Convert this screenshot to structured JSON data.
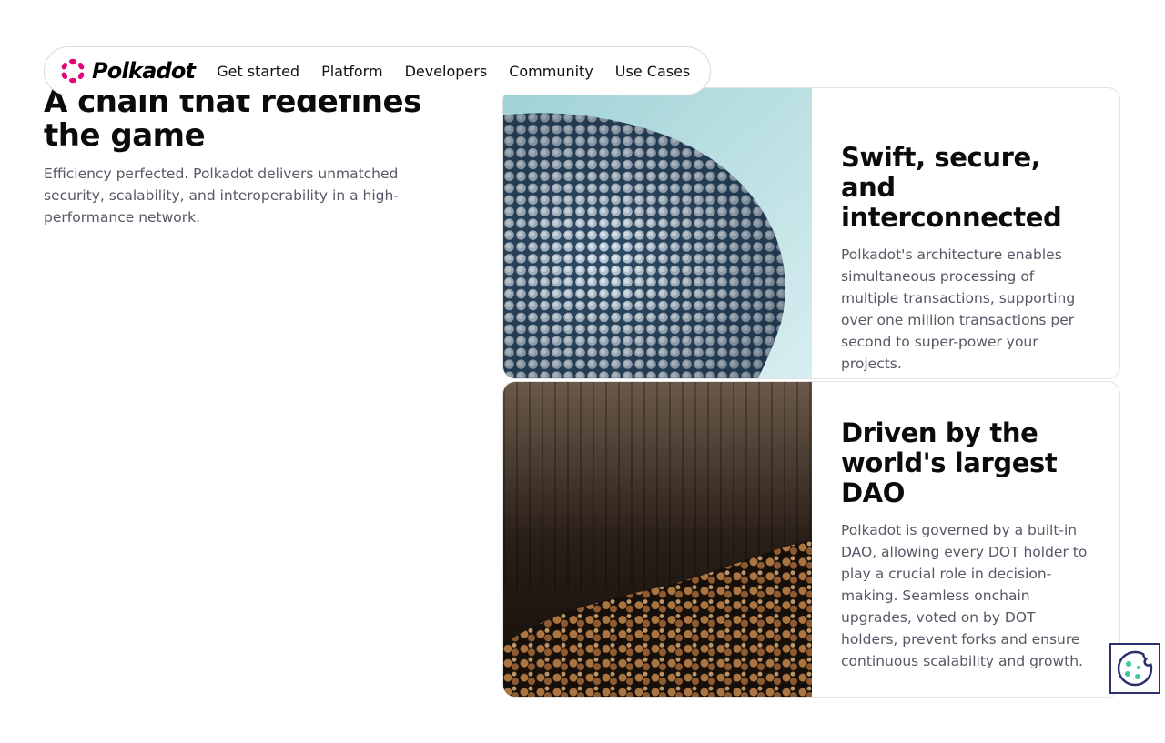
{
  "brand": {
    "name": "Polkadot",
    "accent": "#e6007a"
  },
  "nav": {
    "links": [
      "Get started",
      "Platform",
      "Developers",
      "Community",
      "Use Cases"
    ]
  },
  "hero": {
    "title": "A chain that redefines the game",
    "description": "Efficiency perfected. Polkadot delivers unmatched security, scalability, and interoperability in a high-performance network."
  },
  "cards": [
    {
      "title": "Swift, secure, and interconnected",
      "description": "Polkadot's architecture enables simultaneous processing of multiple transactions, supporting over one million transactions per second to super-power your projects.",
      "image": "building-facade-discs"
    },
    {
      "title": "Driven by the world's largest DAO",
      "description": "Polkadot is governed by a built-in DAO, allowing every DOT holder to play a crucial role in decision-making. Seamless onchain upgrades, voted on by DOT holders, prevent forks and ensure continuous scalability and growth.",
      "image": "concert-crowd"
    }
  ],
  "cookie": {
    "icon": "cookie-icon",
    "color": "#2b2f6b",
    "dot_color": "#3fc8a0"
  }
}
